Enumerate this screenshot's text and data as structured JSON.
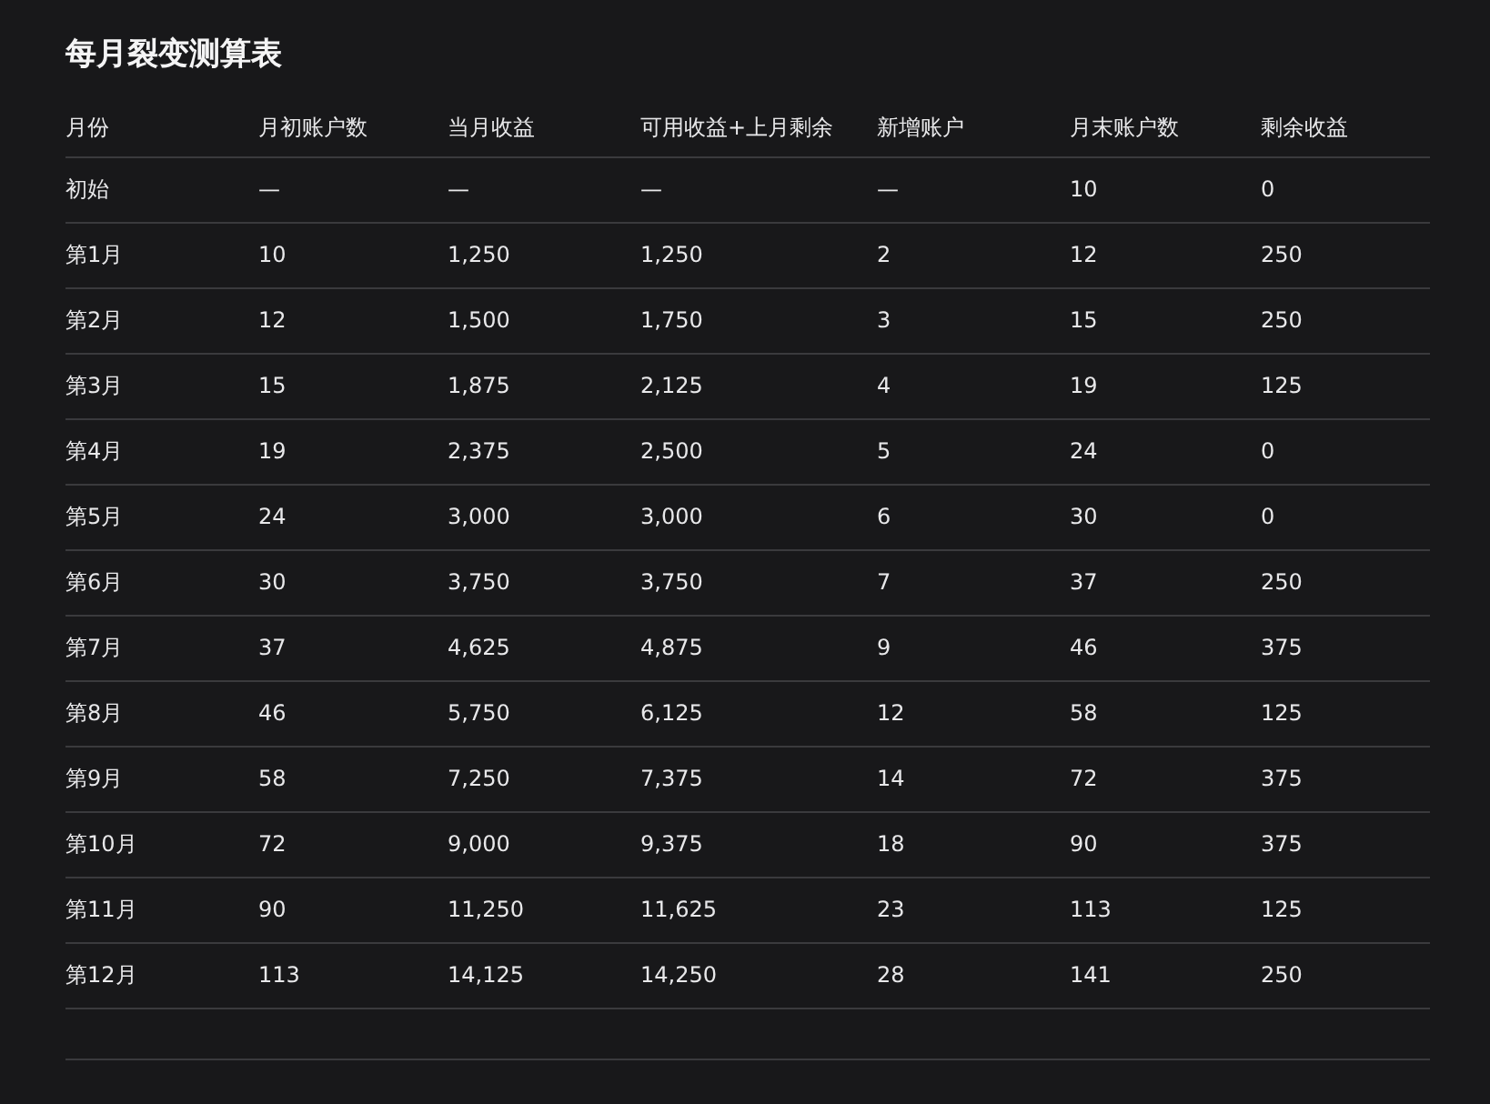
{
  "title": "每月裂变测算表",
  "table": {
    "columns": [
      "月份",
      "月初账户数",
      "当月收益",
      "可用收益+上月剩余",
      "新增账户",
      "月末账户数",
      "剩余收益"
    ],
    "rows": [
      [
        "初始",
        "—",
        "—",
        "—",
        "—",
        "10",
        "0"
      ],
      [
        "第1月",
        "10",
        "1,250",
        "1,250",
        "2",
        "12",
        "250"
      ],
      [
        "第2月",
        "12",
        "1,500",
        "1,750",
        "3",
        "15",
        "250"
      ],
      [
        "第3月",
        "15",
        "1,875",
        "2,125",
        "4",
        "19",
        "125"
      ],
      [
        "第4月",
        "19",
        "2,375",
        "2,500",
        "5",
        "24",
        "0"
      ],
      [
        "第5月",
        "24",
        "3,000",
        "3,000",
        "6",
        "30",
        "0"
      ],
      [
        "第6月",
        "30",
        "3,750",
        "3,750",
        "7",
        "37",
        "250"
      ],
      [
        "第7月",
        "37",
        "4,625",
        "4,875",
        "9",
        "46",
        "375"
      ],
      [
        "第8月",
        "46",
        "5,750",
        "6,125",
        "12",
        "58",
        "125"
      ],
      [
        "第9月",
        "58",
        "7,250",
        "7,375",
        "14",
        "72",
        "375"
      ],
      [
        "第10月",
        "72",
        "9,000",
        "9,375",
        "18",
        "90",
        "375"
      ],
      [
        "第11月",
        "90",
        "11,250",
        "11,625",
        "23",
        "113",
        "125"
      ],
      [
        "第12月",
        "113",
        "14,125",
        "14,250",
        "28",
        "141",
        "250"
      ]
    ]
  }
}
